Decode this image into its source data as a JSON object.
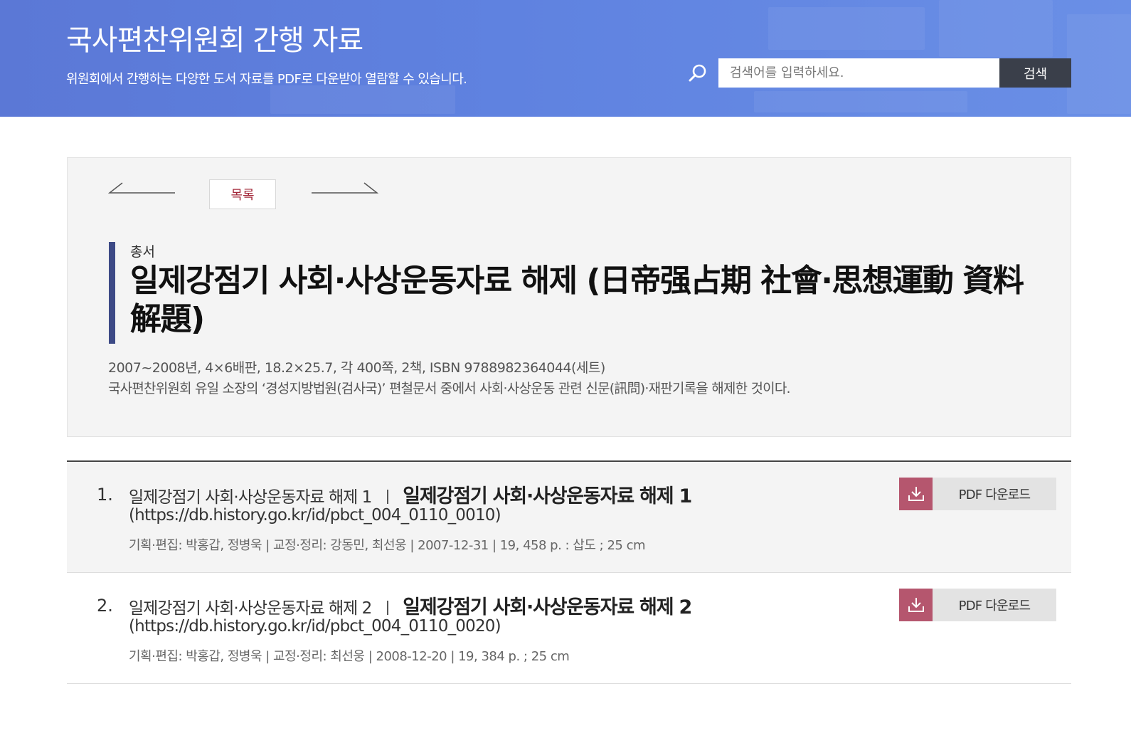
{
  "header": {
    "title": "국사편찬위원회 간행 자료",
    "subtitle": "위원회에서 간행하는 다양한 도서 자료를 PDF로 다운받아 열람할 수 있습니다.",
    "search": {
      "placeholder": "검색어를 입력하세요.",
      "value": "",
      "button_label": "검색",
      "icon": "search-icon"
    },
    "colors": {
      "banner": "#5f82e0",
      "search_button": "#3a3f4a"
    }
  },
  "detail": {
    "nav": {
      "prev_icon": "arrow-left-icon",
      "next_icon": "arrow-right-icon",
      "list_label": "목록"
    },
    "series_label": "총서",
    "title": "일제강점기 사회·사상운동자료 해제 (日帝强占期 社會·思想運動 資料 解題)",
    "meta": "2007~2008년, 4×6배판, 18.2×25.7, 각 400쪽, 2책, ISBN 9788982364044(세트)",
    "description": "국사편찬위원회 유일 소장의 ‘경성지방법원(검사국)’ 편철문서 중에서 사회·사상운동 관련 신문(訊問)·재판기록을 해제한 것이다.",
    "colors": {
      "accent_bar": "#3d4a86",
      "list_label": "#a3283a"
    }
  },
  "volumes": [
    {
      "number": "1.",
      "title_small": "일제강점기 사회·사상운동자료 해제 1",
      "title_big": "일제강점기 사회·사상운동자료 해제 1",
      "url": "(https://db.history.go.kr/id/pbct_004_0110_0010)",
      "meta": "기획·편집: 박홍갑, 정병욱 | 교정·정리: 강동민, 최선웅 | 2007-12-31 | 19, 458 p. : 삽도 ; 25 cm",
      "download_label": "PDF 다운로드",
      "download_icon": "download-icon"
    },
    {
      "number": "2.",
      "title_small": "일제강점기 사회·사상운동자료 해제 2",
      "title_big": "일제강점기 사회·사상운동자료 해제 2",
      "url": "(https://db.history.go.kr/id/pbct_004_0110_0020)",
      "meta": "기획·편집: 박홍갑, 정병욱 | 교정·정리: 최선웅 | 2008-12-20 | 19, 384 p. ; 25 cm",
      "download_label": "PDF 다운로드",
      "download_icon": "download-icon"
    }
  ]
}
